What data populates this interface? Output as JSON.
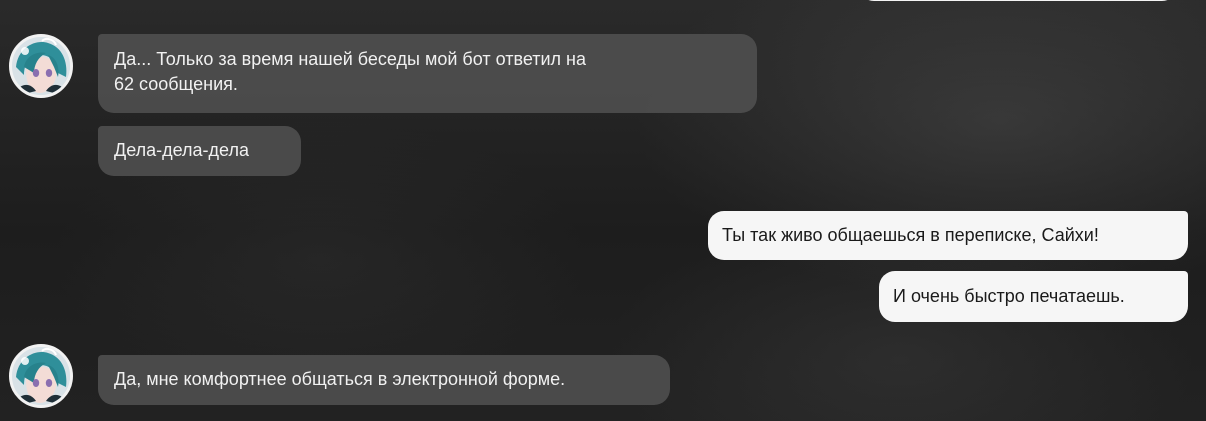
{
  "chat": {
    "messages": [
      {
        "sender": "character",
        "lines": [
          "Да... Только за время нашей беседы мой бот ответил на",
          "62 сообщения."
        ]
      },
      {
        "sender": "character",
        "text": "Дела-дела-дела"
      },
      {
        "sender": "user",
        "text": "Ты так живо общаешься в переписке, Сайхи!"
      },
      {
        "sender": "user",
        "text": "И очень быстро печатаешь."
      },
      {
        "sender": "character",
        "text": "Да, мне комфортнее общаться в электронной форме."
      }
    ]
  },
  "colors": {
    "incoming_bubble": "#4e4e4e",
    "outgoing_bubble": "#f6f6f6",
    "incoming_text": "#f1f1f1",
    "outgoing_text": "#1a1a1a"
  },
  "icons": {
    "avatar": "character-avatar-icon"
  }
}
